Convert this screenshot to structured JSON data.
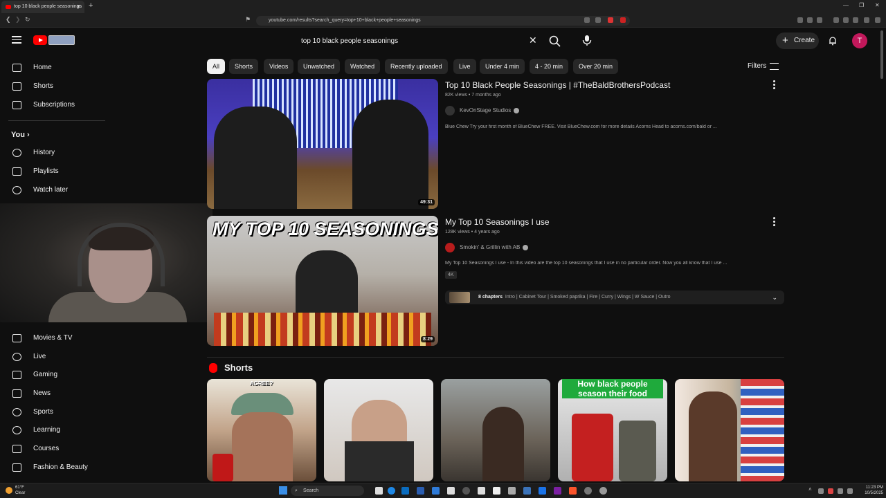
{
  "browser": {
    "tab_title": "top 10 black people seasonings",
    "url": "youtube.com/results?search_query=top+10+black+people+seasonings"
  },
  "header": {
    "search_query": "top 10 black people seasonings",
    "create_label": "Create",
    "avatar_letter": "T",
    "brand_color": "#ff0000"
  },
  "sidebar": {
    "main": [
      {
        "label": "Home",
        "icon": "home-icon"
      },
      {
        "label": "Shorts",
        "icon": "shorts-icon"
      },
      {
        "label": "Subscriptions",
        "icon": "subscriptions-icon"
      }
    ],
    "you_label": "You",
    "you_items": [
      {
        "label": "History",
        "icon": "history-icon"
      },
      {
        "label": "Playlists",
        "icon": "playlists-icon"
      },
      {
        "label": "Watch later",
        "icon": "watch-later-icon"
      }
    ],
    "explore_items": [
      {
        "label": "Movies & TV",
        "icon": "movies-icon"
      },
      {
        "label": "Live",
        "icon": "live-icon"
      },
      {
        "label": "Gaming",
        "icon": "gaming-icon"
      },
      {
        "label": "News",
        "icon": "news-icon"
      },
      {
        "label": "Sports",
        "icon": "sports-icon"
      },
      {
        "label": "Learning",
        "icon": "learning-icon"
      },
      {
        "label": "Courses",
        "icon": "courses-icon"
      },
      {
        "label": "Fashion & Beauty",
        "icon": "fashion-icon"
      }
    ]
  },
  "chips": [
    "All",
    "Shorts",
    "Videos",
    "Unwatched",
    "Watched",
    "Recently uploaded",
    "Live",
    "Under 4 min",
    "4 - 20 min",
    "Over 20 min"
  ],
  "filters_label": "Filters",
  "results": [
    {
      "title": "Top 10 Black People Seasonings | #TheBaldBrothersPodcast",
      "meta": "82K views • 7 months ago",
      "channel": "KevOnStage Studios",
      "description": "Blue Chew Try your first month of BlueChew FREE. Visit BlueChew.com for more details Acorns Head to acorns.com/bald or ...",
      "duration": "49:31"
    },
    {
      "title": "My Top 10 Seasonings I use",
      "meta": "128K views • 4 years ago",
      "channel": "Smokin' & Grillin with AB",
      "description": "My Top 10 Seasonings I use - In this video are the top 10 seasonings that I use in no particular order. Now you all know that I use ...",
      "duration": "8:29",
      "badge": "4K",
      "chapters_label": "8 chapters",
      "chapters_text": "Intro | Cabinet Tour | Smoked paprika | Fire | Curry | Wings | W Sauce | Outro",
      "thumb_text": "MY TOP 10 SEASONINGS"
    }
  ],
  "shorts": {
    "heading": "Shorts",
    "overlay_text": "How black people season their food",
    "short1_text": "AGREE?"
  },
  "taskbar": {
    "search_label": "Search",
    "time": "11:23 PM",
    "date": "10/5/2025",
    "weather": "61°F",
    "weather_sub": "Clear"
  }
}
